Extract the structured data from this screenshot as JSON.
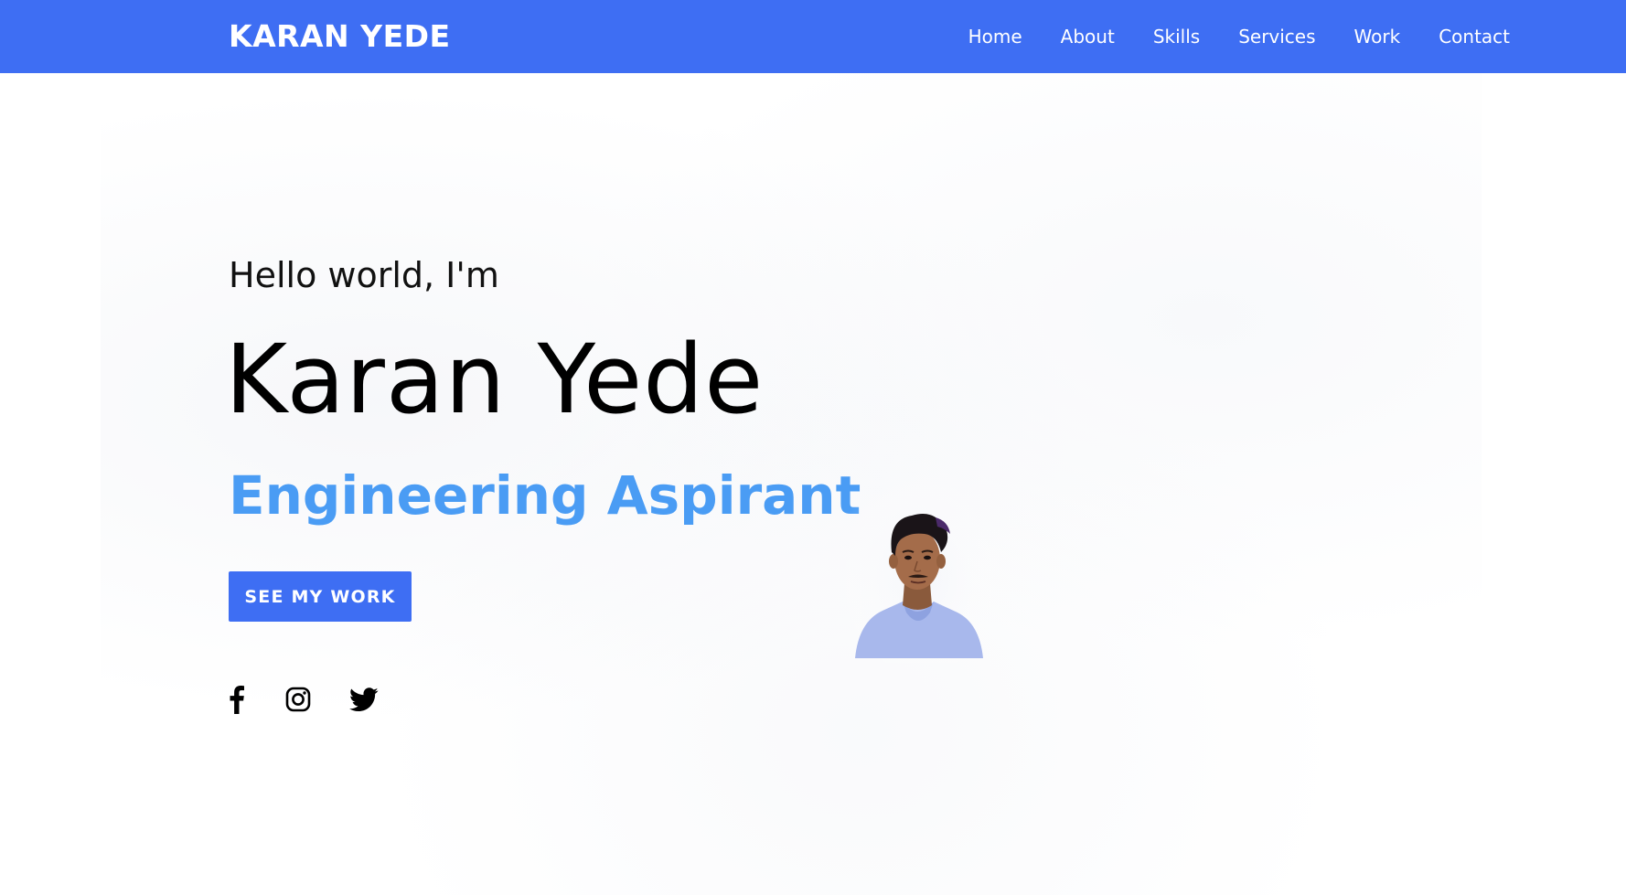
{
  "header": {
    "brand": "KARAN YEDE",
    "nav": [
      {
        "label": "Home"
      },
      {
        "label": "About"
      },
      {
        "label": "Skills"
      },
      {
        "label": "Services"
      },
      {
        "label": "Work"
      },
      {
        "label": "Contact"
      }
    ]
  },
  "hero": {
    "greeting": "Hello world, I'm",
    "name": "Karan Yede",
    "role": "Engineering Aspirant",
    "cta_label": "SEE MY WORK"
  },
  "socials": [
    {
      "icon": "facebook-icon"
    },
    {
      "icon": "instagram-icon"
    },
    {
      "icon": "twitter-icon"
    }
  ],
  "colors": {
    "primary": "#3e6ef3",
    "role_text": "#4a9cf4",
    "heading": "#000000"
  }
}
